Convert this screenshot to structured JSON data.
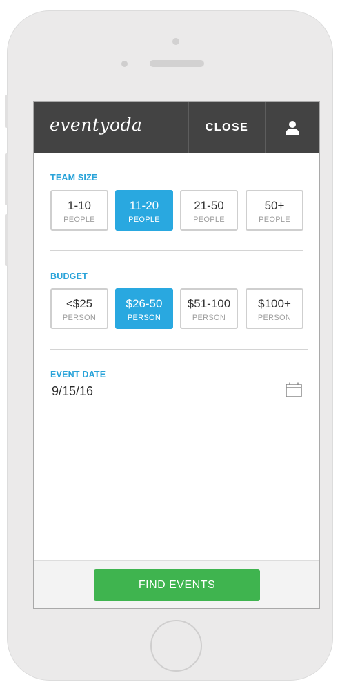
{
  "header": {
    "logo": "eventyoda",
    "close_label": "CLOSE"
  },
  "team_size": {
    "label": "TEAM SIZE",
    "options": [
      {
        "value": "1-10",
        "unit": "PEOPLE",
        "selected": false
      },
      {
        "value": "11-20",
        "unit": "PEOPLE",
        "selected": true
      },
      {
        "value": "21-50",
        "unit": "PEOPLE",
        "selected": false
      },
      {
        "value": "50+",
        "unit": "PEOPLE",
        "selected": false
      }
    ]
  },
  "budget": {
    "label": "BUDGET",
    "options": [
      {
        "value": "<$25",
        "unit": "PERSON",
        "selected": false
      },
      {
        "value": "$26-50",
        "unit": "PERSON",
        "selected": true
      },
      {
        "value": "$51-100",
        "unit": "PERSON",
        "selected": false
      },
      {
        "value": "$100+",
        "unit": "PERSON",
        "selected": false
      }
    ]
  },
  "event_date": {
    "label": "EVENT DATE",
    "value": "9/15/16",
    "icon": "calendar-icon"
  },
  "footer": {
    "find_label": "FIND EVENTS"
  },
  "colors": {
    "accent": "#29a8e0",
    "header_bg": "#434343",
    "cta": "#3fb44f"
  }
}
